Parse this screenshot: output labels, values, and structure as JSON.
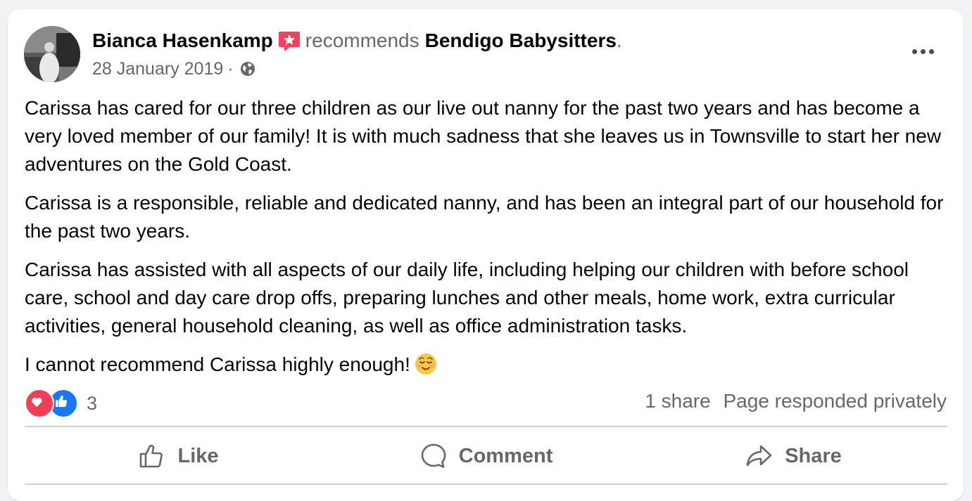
{
  "post": {
    "author": "Bianca Hasenkamp",
    "verb": "recommends",
    "page_name": "Bendigo Babysitters",
    "header_end": ".",
    "date": "28 January 2019",
    "meta_sep": "·",
    "privacy_icon": "globe-icon",
    "paragraphs": [
      "Carissa has cared for our three children as our live out nanny for the past two years and has become a very loved member of our family! It is with much sadness that she leaves us in Townsville to start her new adventures on the Gold Coast.",
      "Carissa is a responsible, reliable and dedicated nanny, and has been an integral part of our household for the past two years.",
      "Carissa has assisted with all aspects of our daily life, including helping our children with before school care, school and day care drop offs, preparing lunches and other meals, home work, extra curricular activities, general household cleaning, as well as office administration tasks.",
      "I cannot recommend Carissa highly enough!"
    ],
    "emoji": "relieved-face-emoji"
  },
  "stats": {
    "reaction_count": "3",
    "shares": "1 share",
    "response": "Page responded privately"
  },
  "actions": {
    "like": "Like",
    "comment": "Comment",
    "share": "Share"
  },
  "colors": {
    "text": "#050505",
    "secondary": "#65676b",
    "badge": "#f3425f",
    "like_blue": "#1877f2",
    "love_red": "#f33e58",
    "divider": "#ced0d4",
    "background": "#f0f2f5"
  }
}
